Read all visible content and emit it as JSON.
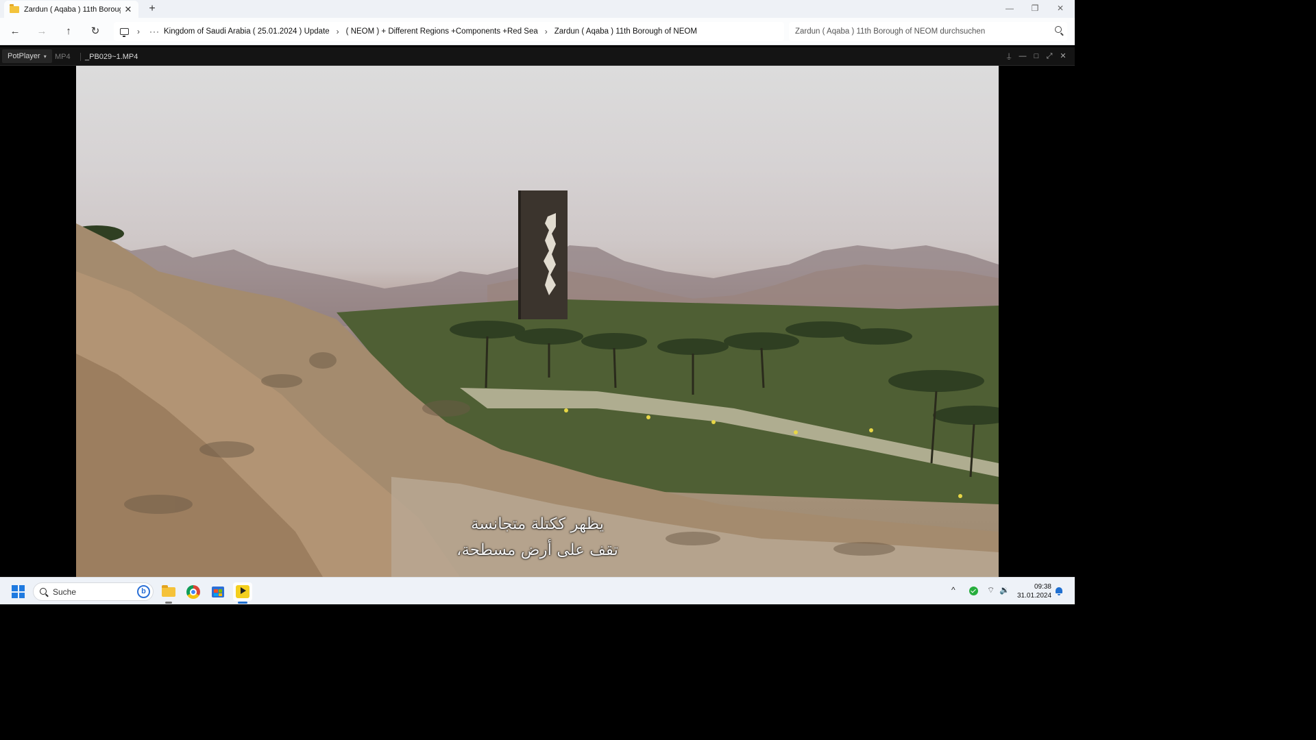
{
  "explorer": {
    "tab_title": "Zardun ( Aqaba )  11th Borough",
    "tab_close": "✕",
    "new_tab": "+",
    "window": {
      "minimize": "—",
      "restore": "❐",
      "close": "✕"
    },
    "nav": {
      "back": "←",
      "forward": "→",
      "up": "↑",
      "refresh": "↻",
      "more": "···",
      "sep": "›"
    },
    "breadcrumbs": [
      "Kingdom of Saudi Arabia ( 25.01.2024 ) Update",
      "( NEOM ) + Different Regions +Components +Red Sea",
      "Zardun ( Aqaba )  11th Borough of NEOM"
    ],
    "search_placeholder": "Zardun ( Aqaba )  11th Borough of NEOM durchsuchen"
  },
  "player": {
    "menu_label": "PotPlayer",
    "menu_caret": "▾",
    "format": "MP4",
    "file_name": "_PB029~1.MP4",
    "controls": {
      "pin": "⍊",
      "minimize": "—",
      "maximize": "□",
      "fullscreen": "⤢",
      "close": "✕"
    },
    "subtitles": [
      "يظهر ككتلة متجانسة",
      "تقف على أرض مسطحة،"
    ]
  },
  "taskbar": {
    "search_label": "Suche",
    "bing_label": "b",
    "tray_chevron": "^",
    "wifi": "⌔",
    "volume": "🔉",
    "time": "09:38",
    "date": "31.01.2024"
  }
}
